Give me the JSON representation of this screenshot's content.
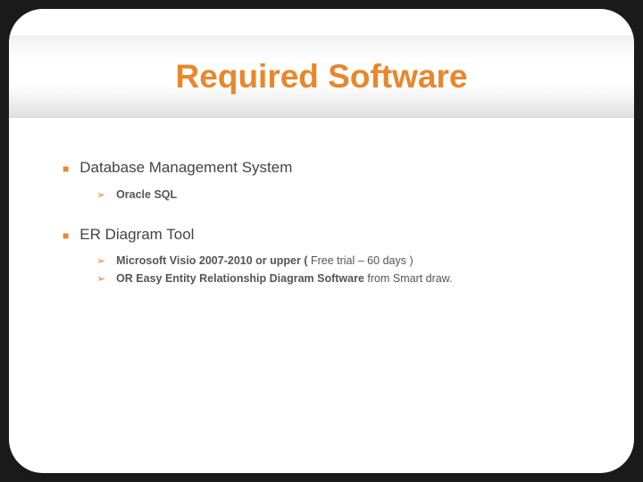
{
  "slide": {
    "title": "Required Software",
    "sections": [
      {
        "heading": "Database Management System",
        "items": [
          {
            "text_bold": "Oracle SQL",
            "text_normal": ""
          }
        ]
      },
      {
        "heading": "ER Diagram Tool",
        "items": [
          {
            "text_bold": "Microsoft Visio 2007-2010 or upper  (",
            "text_normal": " Free trial – 60 days )"
          },
          {
            "text_bold": " OR Easy Entity Relationship Diagram Software",
            "text_normal": " from Smart draw."
          }
        ]
      }
    ]
  },
  "colors": {
    "accent": "#e8872b"
  }
}
